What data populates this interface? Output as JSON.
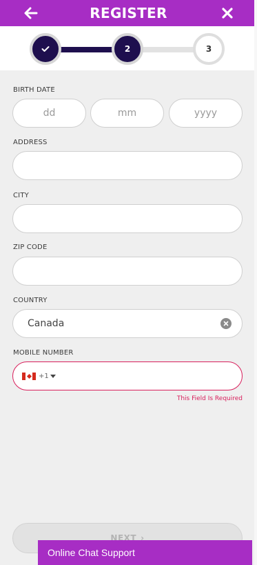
{
  "header": {
    "title": "REGISTER",
    "back_icon": "arrow-left-icon",
    "close_icon": "close-icon"
  },
  "stepper": {
    "steps": [
      {
        "label": "",
        "state": "completed",
        "icon": "check-icon"
      },
      {
        "label": "2",
        "state": "active"
      },
      {
        "label": "3",
        "state": "pending"
      }
    ],
    "progress": "1 of 2 segments complete"
  },
  "form": {
    "birth_date": {
      "label": "BIRTH DATE",
      "day_placeholder": "dd",
      "month_placeholder": "mm",
      "year_placeholder": "yyyy"
    },
    "address": {
      "label": "ADDRESS",
      "value": ""
    },
    "city": {
      "label": "CITY",
      "value": ""
    },
    "zip": {
      "label": "ZIP CODE",
      "value": ""
    },
    "country": {
      "label": "COUNTRY",
      "value": "Canada",
      "clear_icon": "clear-circle-icon"
    },
    "mobile": {
      "label": "MOBILE NUMBER",
      "flag": "canada-flag-icon",
      "dial_code": "+1",
      "value": "",
      "error": "This Field Is Required"
    }
  },
  "next_button": {
    "label": "NEXT",
    "icon": "chevron-right-icon"
  },
  "chat": {
    "label": "Online Chat Support"
  },
  "colors": {
    "brand": "#a72dc4",
    "step_active": "#1e0f4e",
    "error": "#d81e5b",
    "background": "#efefef"
  }
}
